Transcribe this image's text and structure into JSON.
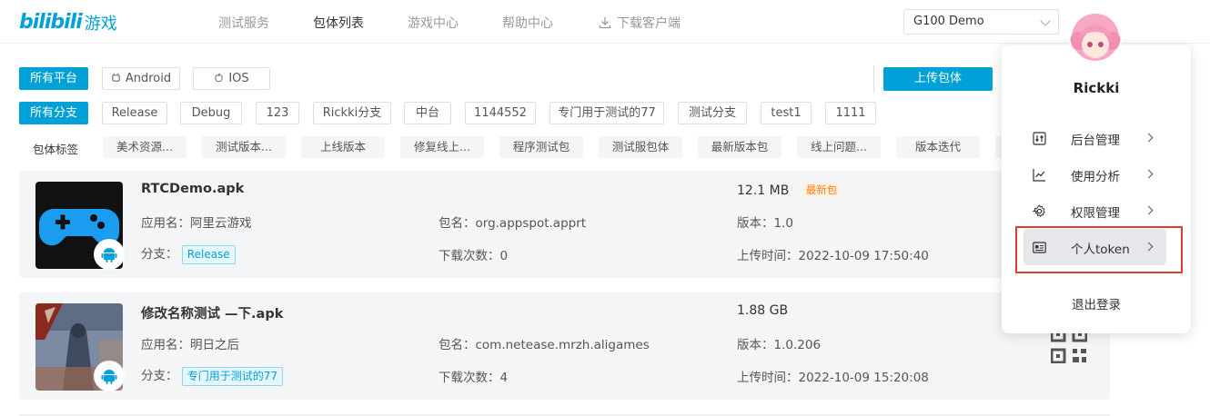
{
  "header": {
    "logo_text": "bilibili",
    "logo_suffix": "游戏",
    "nav": [
      {
        "label": "测试服务"
      },
      {
        "label": "包体列表"
      },
      {
        "label": "游戏中心"
      },
      {
        "label": "帮助中心"
      },
      {
        "label": "下载客户端"
      }
    ],
    "project_select": "G100 Demo"
  },
  "filters": {
    "platforms": [
      "所有平台",
      "Android",
      "IOS"
    ],
    "branches": [
      "所有分支",
      "Release",
      "Debug",
      "123",
      "Rickki分支",
      "中台",
      "1144552",
      "专门用于测试的77",
      "测试分支",
      "test1",
      "1111"
    ],
    "tags_label": "包体标签",
    "tags": [
      "美术资源...",
      "测试版本...",
      "上线版本",
      "修复线上...",
      "程序测试包",
      "测试服包体",
      "最新版本包",
      "线上问题...",
      "版本迭代"
    ],
    "upload_button": "上传包体"
  },
  "packages": [
    {
      "name": "RTCDemo.apk",
      "app_name": "应用名：阿里云游戏",
      "package": "包名：org.appspot.apprt",
      "size": "12.1 MB",
      "badge": "最新包",
      "version": "版本：1.0",
      "branch_label": "分支：",
      "branch": "Release",
      "downloads": "下载次数：0",
      "upload_time": "上传时间：2022-10-09 17:50:40"
    },
    {
      "name": "修改名称测试 —下.apk",
      "app_name": "应用名：明日之后",
      "package": "包名：com.netease.mrzh.aligames",
      "size": "1.88 GB",
      "version": "版本：1.0.206",
      "branch_label": "分支：",
      "branch": "专门用于测试的77",
      "downloads": "下载次数：4",
      "upload_time": "上传时间：2022-10-09 15:20:08"
    }
  ],
  "user_menu": {
    "username": "Rickki",
    "items": [
      {
        "label": "后台管理",
        "icon": "sliders-icon"
      },
      {
        "label": "使用分析",
        "icon": "chart-icon"
      },
      {
        "label": "权限管理",
        "icon": "gear-icon"
      },
      {
        "label": "个人token",
        "icon": "id-card-icon"
      }
    ],
    "logout": "退出登录",
    "highlight_color": "#e53935"
  },
  "colors": {
    "accent": "#00a1d6",
    "badge_new": "#ff7f24"
  }
}
